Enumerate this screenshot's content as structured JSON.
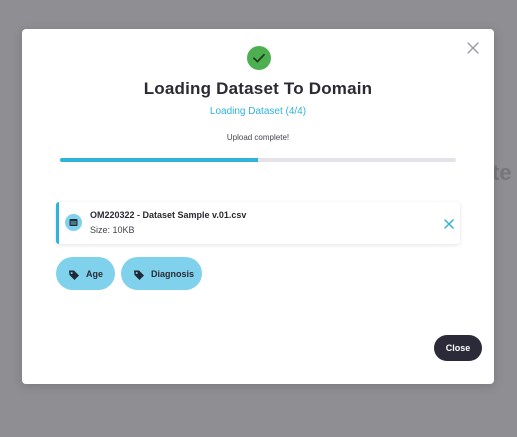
{
  "background": {
    "partial_text": "te"
  },
  "modal": {
    "title": "Loading Dataset To Domain",
    "subtitle": "Loading Dataset (4/4)",
    "status": "Upload complete!",
    "progress_fraction": 0.5,
    "success_icon": "check-circle-icon",
    "close_icon": "close-x-icon"
  },
  "file": {
    "name": "OM220322 - Dataset Sample v.01.csv",
    "size": "Size: 10KB",
    "icon": "dataset-icon",
    "remove_icon": "close-x-icon"
  },
  "tags": [
    {
      "label": "Age",
      "icon": "tag-icon"
    },
    {
      "label": "Diagnosis",
      "icon": "tag-icon"
    }
  ],
  "footer": {
    "close_label": "Close"
  },
  "colors": {
    "accent": "#2fb3dd",
    "tag_bg": "#7fd1ec",
    "success": "#4caf50",
    "button_dark": "#2a2a38",
    "overlay": "#8f8e93"
  }
}
